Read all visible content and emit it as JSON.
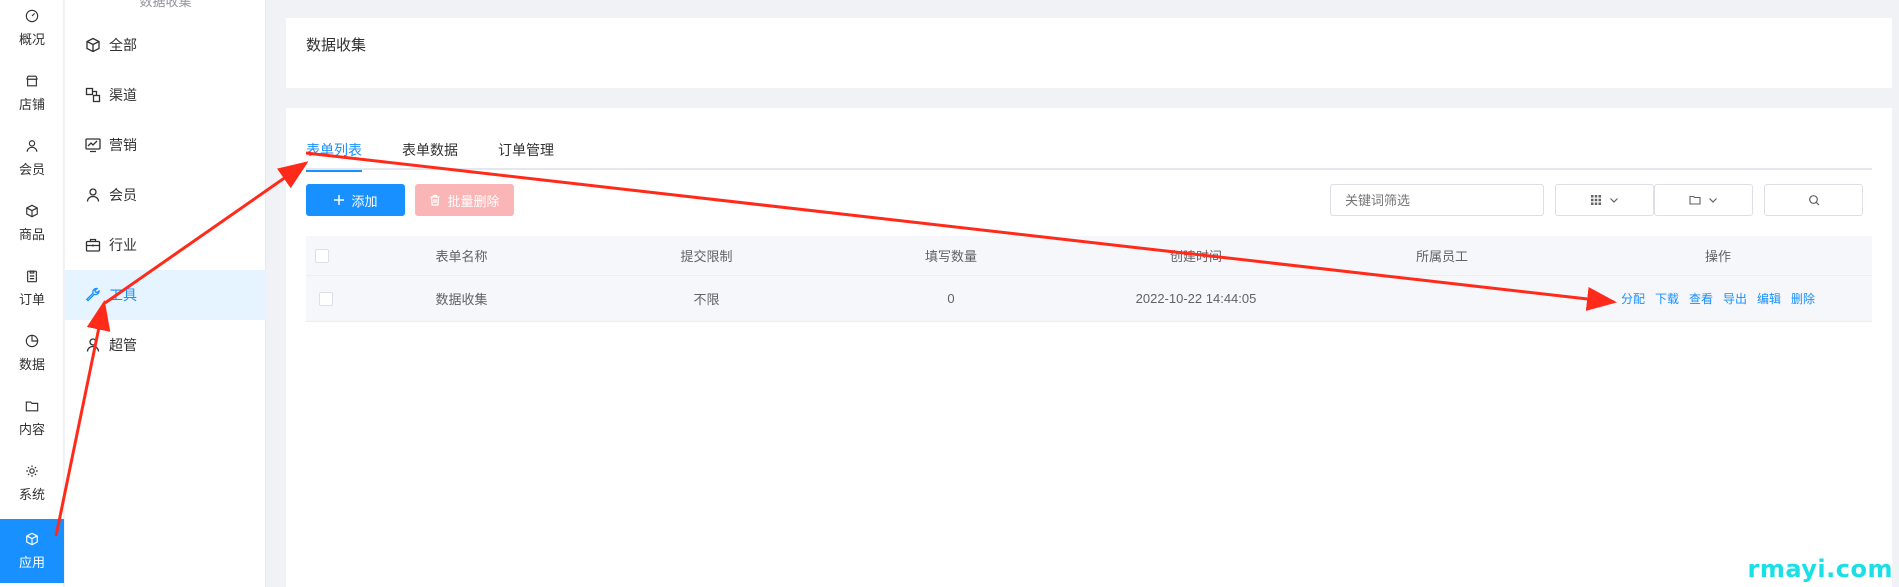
{
  "rail": {
    "items": [
      {
        "label": "概况",
        "icon": "dashboard-icon"
      },
      {
        "label": "店铺",
        "icon": "store-icon"
      },
      {
        "label": "会员",
        "icon": "user-icon"
      },
      {
        "label": "商品",
        "icon": "box-icon"
      },
      {
        "label": "订单",
        "icon": "clipboard-icon"
      },
      {
        "label": "数据",
        "icon": "pie-chart-icon"
      },
      {
        "label": "内容",
        "icon": "folder-icon"
      },
      {
        "label": "系统",
        "icon": "gear-icon"
      },
      {
        "label": "应用",
        "icon": "cube-icon",
        "active": true
      }
    ]
  },
  "submenu": {
    "title": "数据收集",
    "items": [
      {
        "label": "全部",
        "icon": "cube-icon"
      },
      {
        "label": "渠道",
        "icon": "channel-icon"
      },
      {
        "label": "营销",
        "icon": "trend-icon"
      },
      {
        "label": "会员",
        "icon": "user-icon"
      },
      {
        "label": "行业",
        "icon": "briefcase-icon"
      },
      {
        "label": "工具",
        "icon": "wrench-icon",
        "active": true
      },
      {
        "label": "超管",
        "icon": "admin-icon"
      }
    ]
  },
  "header": {
    "title": "数据收集"
  },
  "tabs": [
    {
      "label": "表单列表",
      "active": true
    },
    {
      "label": "表单数据"
    },
    {
      "label": "订单管理"
    }
  ],
  "toolbar": {
    "add_label": "添加",
    "batch_delete_label": "批量删除",
    "search_placeholder": "关键词筛选"
  },
  "table": {
    "columns": [
      "表单名称",
      "提交限制",
      "填写数量",
      "创建时间",
      "所属员工",
      "操作"
    ],
    "rows": [
      {
        "name": "数据收集",
        "limit": "不限",
        "count": "0",
        "created": "2022-10-22 14:44:05",
        "staff": "",
        "actions": [
          "分配",
          "下载",
          "查看",
          "导出",
          "编辑",
          "删除"
        ]
      }
    ]
  },
  "colors": {
    "accent": "#1890ff",
    "annotation": "#ff2a1a",
    "watermark": "#18e0e6"
  },
  "watermark": "rmayi.com"
}
